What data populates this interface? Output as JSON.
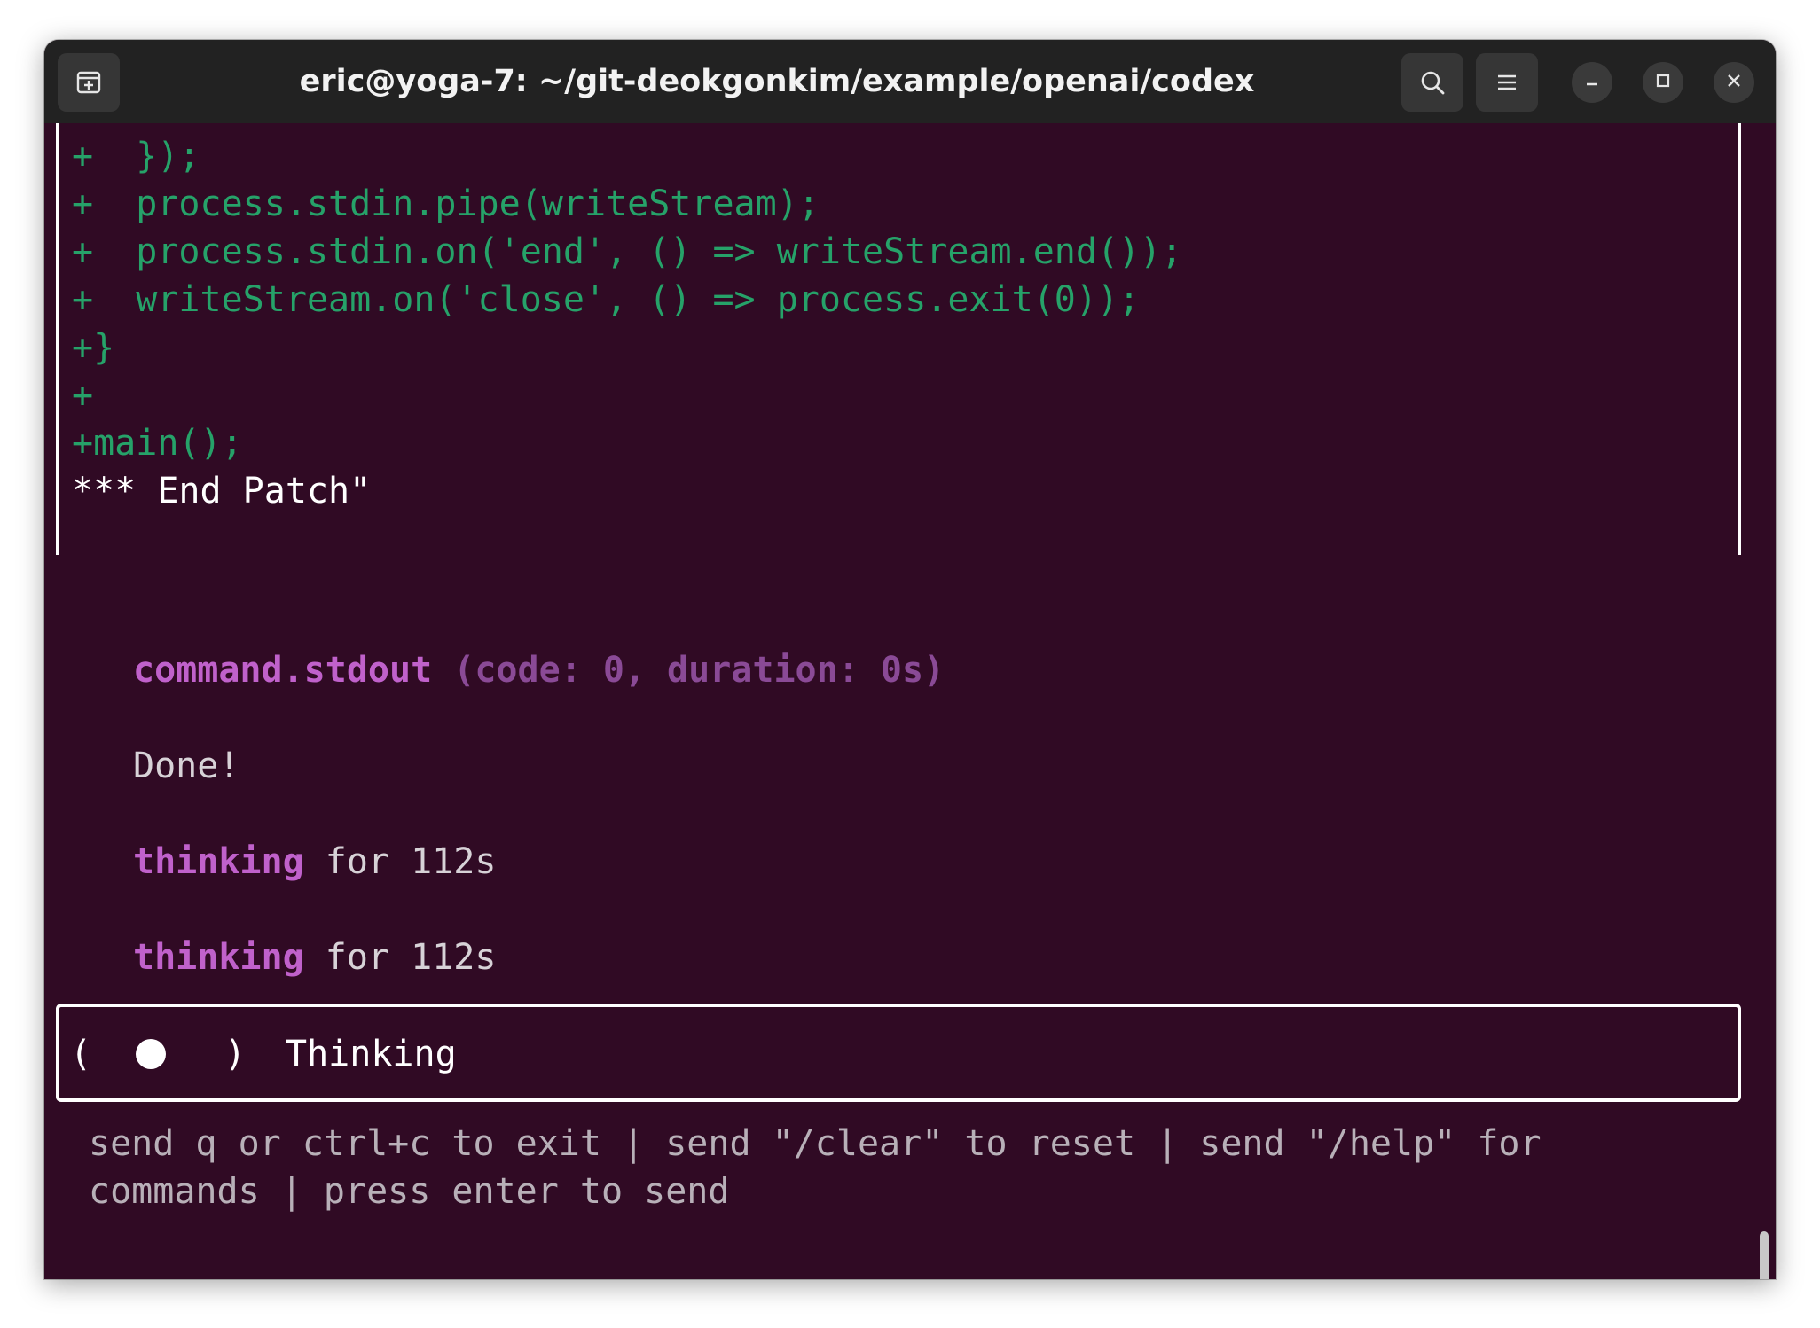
{
  "window": {
    "title": "eric@yoga-7: ~/git-deokgonkim/example/openai/codex"
  },
  "titlebar": {
    "new_tab_icon": "new-tab-icon",
    "search_icon": "search-icon",
    "menu_icon": "hamburger-menu-icon",
    "minimize_icon": "minimize-icon",
    "maximize_icon": "maximize-icon",
    "close_icon": "close-icon"
  },
  "patch": {
    "lines": [
      "+  });",
      "+  process.stdin.pipe(writeStream);",
      "+  process.stdin.on('end', () => writeStream.end());",
      "+  writeStream.on('close', () => process.exit(0));",
      "+}",
      "+",
      "+main();",
      "*** End Patch\""
    ]
  },
  "output": {
    "stdout_label": "command.stdout",
    "stdout_meta": " (code: 0, duration: 0s)",
    "done_text": "Done!",
    "thinking": [
      {
        "keyword": "thinking",
        "rest": " for 112s"
      },
      {
        "keyword": "thinking",
        "rest": " for 112s"
      }
    ]
  },
  "status": {
    "open_paren": "(",
    "close_paren": ")",
    "label": "Thinking"
  },
  "help": {
    "line1": "send q or ctrl+c to exit | send \"/clear\" to reset | send \"/help\" for",
    "line2": "commands | press enter to send"
  },
  "colors": {
    "background": "#300a24",
    "diff_green": "#26a269",
    "accent_magenta": "#c061cb",
    "titlebar": "#222222"
  }
}
